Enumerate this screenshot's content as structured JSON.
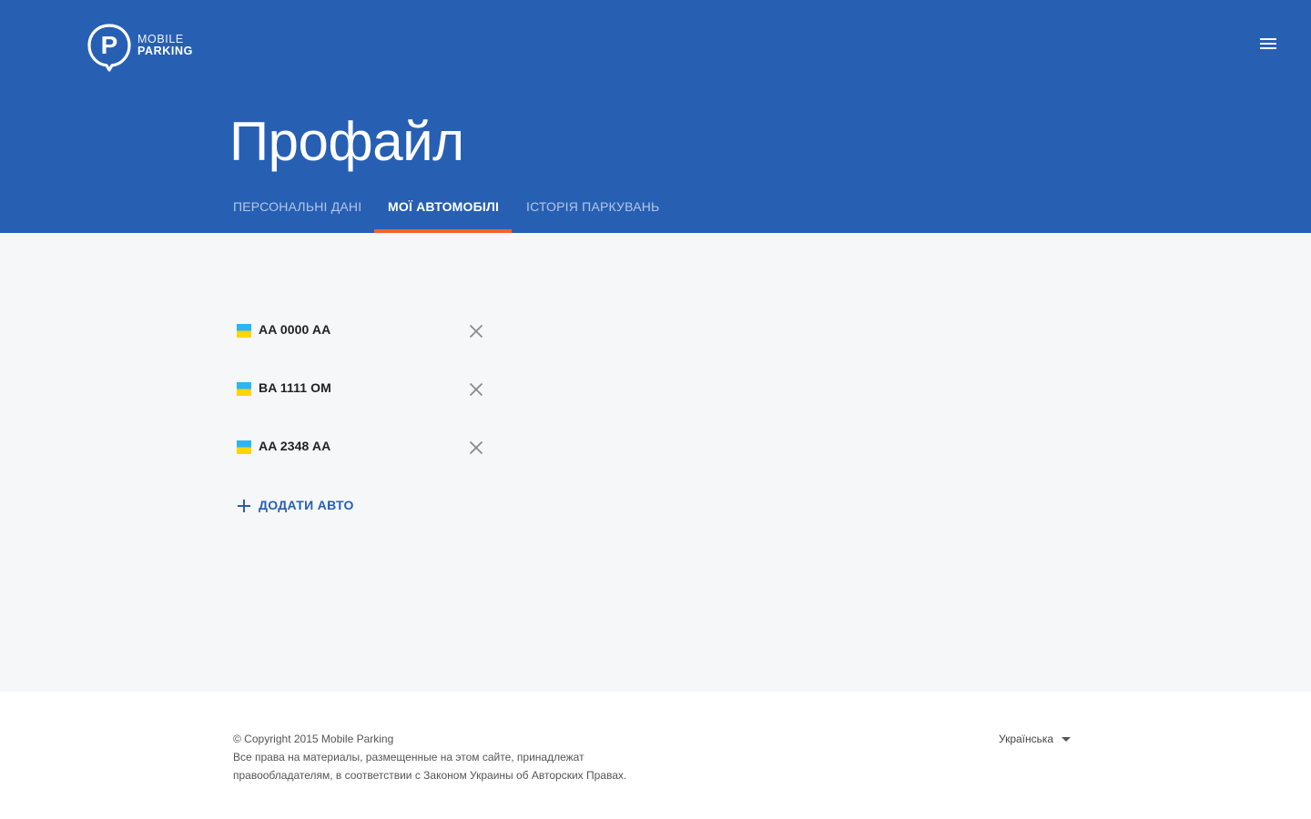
{
  "brand": {
    "line1": "MOBILE",
    "line2": "PARKING",
    "logo_letter": "P",
    "color": "#275fb3"
  },
  "header": {
    "menu_icon": "hamburger-icon"
  },
  "page": {
    "title": "Профайл"
  },
  "tabs": [
    {
      "label": "ПЕРСОНАЛЬНІ ДАНІ",
      "active": false
    },
    {
      "label": "МОЇ АВТОМОБІЛІ",
      "active": true
    },
    {
      "label": "ІСТОРІЯ ПАРКУВАНЬ",
      "active": false
    }
  ],
  "accent_color": "#f4622d",
  "cars": [
    {
      "plate": "AA 0000 AA",
      "flag": "ukraine-flag-icon"
    },
    {
      "plate": "BA 1111 OM",
      "flag": "ukraine-flag-icon"
    },
    {
      "plate": "AA 2348 AA",
      "flag": "ukraine-flag-icon"
    }
  ],
  "add_car": {
    "label": "ДОДАТИ АВТО",
    "icon": "plus-icon"
  },
  "footer": {
    "copyright": "© Copyright 2015 Mobile Parking",
    "rights": "Все права на материалы, размещенные на этом сайте, принадлежат правообладателям, в соответствии с Законом Украины об Авторских Правах.",
    "language": "Українська"
  }
}
